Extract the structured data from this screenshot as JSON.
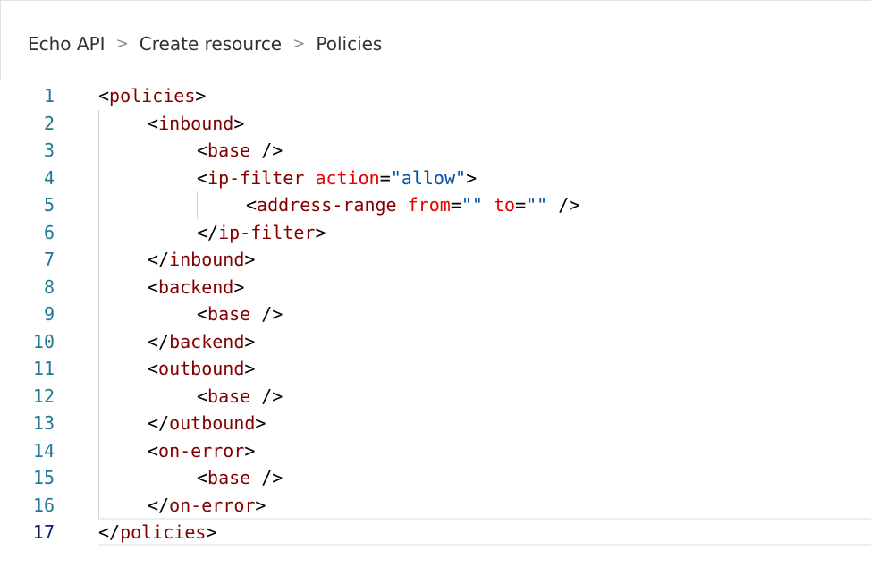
{
  "breadcrumb": {
    "items": [
      "Echo API",
      "Create resource",
      "Policies"
    ],
    "separator": ">"
  },
  "editor": {
    "active_line": 17,
    "lines": [
      {
        "n": "1",
        "indent": 0,
        "tokens": [
          [
            "p",
            "<"
          ],
          [
            "t",
            "policies"
          ],
          [
            "p",
            ">"
          ]
        ]
      },
      {
        "n": "2",
        "indent": 1,
        "tokens": [
          [
            "p",
            "<"
          ],
          [
            "t",
            "inbound"
          ],
          [
            "p",
            ">"
          ]
        ]
      },
      {
        "n": "3",
        "indent": 2,
        "tokens": [
          [
            "p",
            "<"
          ],
          [
            "t",
            "base"
          ],
          [
            "p",
            " />"
          ]
        ]
      },
      {
        "n": "4",
        "indent": 2,
        "tokens": [
          [
            "p",
            "<"
          ],
          [
            "t",
            "ip-filter"
          ],
          [
            "p",
            " "
          ],
          [
            "a",
            "action"
          ],
          [
            "p",
            "="
          ],
          [
            "s",
            "\"allow\""
          ],
          [
            "p",
            ">"
          ]
        ]
      },
      {
        "n": "5",
        "indent": 3,
        "tokens": [
          [
            "p",
            "<"
          ],
          [
            "t",
            "address-range"
          ],
          [
            "p",
            " "
          ],
          [
            "a",
            "from"
          ],
          [
            "p",
            "="
          ],
          [
            "s",
            "\"\""
          ],
          [
            "p",
            " "
          ],
          [
            "a",
            "to"
          ],
          [
            "p",
            "="
          ],
          [
            "s",
            "\"\""
          ],
          [
            "p",
            " />"
          ]
        ]
      },
      {
        "n": "6",
        "indent": 2,
        "tokens": [
          [
            "p",
            "</"
          ],
          [
            "t",
            "ip-filter"
          ],
          [
            "p",
            ">"
          ]
        ]
      },
      {
        "n": "7",
        "indent": 1,
        "tokens": [
          [
            "p",
            "</"
          ],
          [
            "t",
            "inbound"
          ],
          [
            "p",
            ">"
          ]
        ]
      },
      {
        "n": "8",
        "indent": 1,
        "tokens": [
          [
            "p",
            "<"
          ],
          [
            "t",
            "backend"
          ],
          [
            "p",
            ">"
          ]
        ]
      },
      {
        "n": "9",
        "indent": 2,
        "tokens": [
          [
            "p",
            "<"
          ],
          [
            "t",
            "base"
          ],
          [
            "p",
            " />"
          ]
        ]
      },
      {
        "n": "10",
        "indent": 1,
        "tokens": [
          [
            "p",
            "</"
          ],
          [
            "t",
            "backend"
          ],
          [
            "p",
            ">"
          ]
        ]
      },
      {
        "n": "11",
        "indent": 1,
        "tokens": [
          [
            "p",
            "<"
          ],
          [
            "t",
            "outbound"
          ],
          [
            "p",
            ">"
          ]
        ]
      },
      {
        "n": "12",
        "indent": 2,
        "tokens": [
          [
            "p",
            "<"
          ],
          [
            "t",
            "base"
          ],
          [
            "p",
            " />"
          ]
        ]
      },
      {
        "n": "13",
        "indent": 1,
        "tokens": [
          [
            "p",
            "</"
          ],
          [
            "t",
            "outbound"
          ],
          [
            "p",
            ">"
          ]
        ]
      },
      {
        "n": "14",
        "indent": 1,
        "tokens": [
          [
            "p",
            "<"
          ],
          [
            "t",
            "on-error"
          ],
          [
            "p",
            ">"
          ]
        ]
      },
      {
        "n": "15",
        "indent": 2,
        "tokens": [
          [
            "p",
            "<"
          ],
          [
            "t",
            "base"
          ],
          [
            "p",
            " />"
          ]
        ]
      },
      {
        "n": "16",
        "indent": 1,
        "tokens": [
          [
            "p",
            "</"
          ],
          [
            "t",
            "on-error"
          ],
          [
            "p",
            ">"
          ]
        ]
      },
      {
        "n": "17",
        "indent": 0,
        "tokens": [
          [
            "p",
            "</"
          ],
          [
            "t",
            "policies"
          ],
          [
            "p",
            ">"
          ]
        ]
      }
    ]
  },
  "colors": {
    "tag": "#800000",
    "attribute": "#e50000",
    "string": "#0451a5",
    "line_number": "#237893",
    "active_line_number": "#0b216f"
  }
}
